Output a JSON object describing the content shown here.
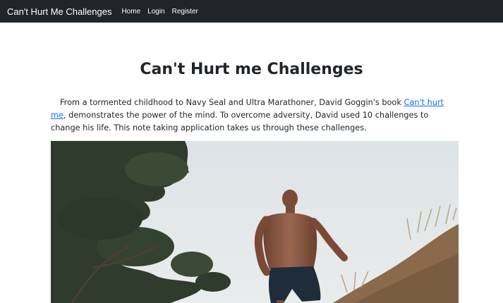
{
  "navbar": {
    "brand": "Can't Hurt Me Challenges",
    "links": [
      "Home",
      "Login",
      "Register"
    ]
  },
  "main": {
    "title": "Can't Hurt me Challenges",
    "intro_before_link": "From a tormented childhood to Navy Seal and Ultra Marathoner, David Goggin's book ",
    "book_link_text": "Can't hurt me",
    "intro_after_link": ", demonstrates the power of the mind. To overcome adversity, David used 10 challenges to change his life. This note taking application takes us through these challenges."
  },
  "colors": {
    "navbar_bg": "#212529",
    "link": "#0d6efd",
    "text": "#212529"
  }
}
